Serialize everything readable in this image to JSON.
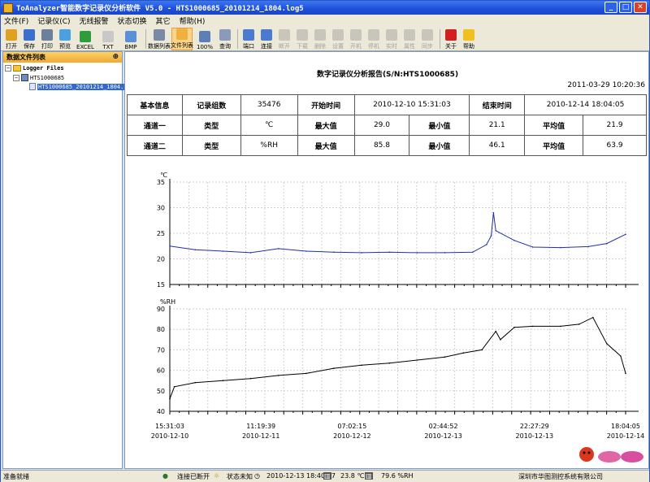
{
  "window": {
    "title": "ToAnalyzer智能数字记录仪分析软件 V5.0 - HTS1000685_20101214_1804.log5"
  },
  "menu": [
    "文件(F)",
    "记录仪(C)",
    "无线报警",
    "状态切换",
    "其它",
    "帮助(H)"
  ],
  "toolbar": [
    {
      "label": "打开",
      "color": "#e0a020",
      "enabled": true
    },
    {
      "label": "保存",
      "color": "#3a6fd0",
      "enabled": true
    },
    {
      "label": "打印",
      "color": "#6d7f9a",
      "enabled": true
    },
    {
      "label": "预览",
      "color": "#4aa0e0",
      "enabled": true
    },
    {
      "label": "EXCEL",
      "color": "#2f9c3c",
      "enabled": true
    },
    {
      "label": "TXT",
      "color": "#c8c8c8",
      "enabled": true
    },
    {
      "label": "BMP",
      "color": "#5b8fd8",
      "enabled": true
    },
    {
      "label": "数据列表",
      "color": "#7a8aa6",
      "enabled": true
    },
    {
      "label": "文件列表",
      "color": "#f0b040",
      "enabled": true,
      "selected": true
    },
    {
      "label": "100%",
      "color": "#5d7fb8",
      "enabled": true
    },
    {
      "label": "查询",
      "color": "#8a9ab8",
      "enabled": true
    },
    {
      "label": "端口",
      "color": "#4b7bd0",
      "enabled": true
    },
    {
      "label": "连接",
      "color": "#4b7bd0",
      "enabled": true
    },
    {
      "label": "断开",
      "color": "#888888",
      "enabled": false
    },
    {
      "label": "下载",
      "color": "#888888",
      "enabled": false
    },
    {
      "label": "删除",
      "color": "#888888",
      "enabled": false
    },
    {
      "label": "设置",
      "color": "#888888",
      "enabled": false
    },
    {
      "label": "开机",
      "color": "#888888",
      "enabled": false
    },
    {
      "label": "停机",
      "color": "#888888",
      "enabled": false
    },
    {
      "label": "实时",
      "color": "#888888",
      "enabled": false
    },
    {
      "label": "属性",
      "color": "#888888",
      "enabled": false
    },
    {
      "label": "同步",
      "color": "#888888",
      "enabled": false
    },
    {
      "label": "关于",
      "color": "#d02020",
      "enabled": true
    },
    {
      "label": "帮助",
      "color": "#f0c020",
      "enabled": true
    }
  ],
  "sidebar": {
    "title": "数据文件列表",
    "pin": "⊕",
    "root": "Logger Files",
    "device": "HTS1000685",
    "file": "HTS1000685_20101214_1804.log5"
  },
  "report": {
    "title": "数字记录仪分析报告(S/N:HTS1000685)",
    "date": "2011-03-29 10:20:36",
    "rows": [
      [
        "基本信息",
        "记录组数",
        "35476",
        "开始时间",
        "2010-12-10 15:31:03",
        "结束时间",
        "2010-12-14 18:04:05"
      ],
      [
        "通道一",
        "类型",
        "℃",
        "最大值",
        "29.0",
        "最小值",
        "21.1",
        "平均值",
        "21.9"
      ],
      [
        "通道二",
        "类型",
        "%RH",
        "最大值",
        "85.8",
        "最小值",
        "46.1",
        "平均值",
        "63.9"
      ]
    ]
  },
  "chart_data": [
    {
      "type": "line",
      "title": "",
      "ylabel": "℃",
      "xlabel": "",
      "ylim": [
        15,
        35
      ],
      "yticks": [
        15,
        20,
        25,
        30,
        35
      ],
      "grid": true,
      "color": "#1f2fa8",
      "x": [
        "2010-12-10 15:31",
        "2010-12-10 21:00",
        "2010-12-11 03:00",
        "2010-12-11 09:00",
        "2010-12-11 15:00",
        "2010-12-11 21:00",
        "2010-12-12 03:00",
        "2010-12-12 09:00",
        "2010-12-12 15:00",
        "2010-12-12 21:00",
        "2010-12-13 03:00",
        "2010-12-13 09:00",
        "2010-12-13 12:00",
        "2010-12-13 13:00",
        "2010-12-13 13:30",
        "2010-12-13 14:00",
        "2010-12-13 18:00",
        "2010-12-13 22:00",
        "2010-12-14 04:00",
        "2010-12-14 10:00",
        "2010-12-14 14:00",
        "2010-12-14 18:04"
      ],
      "values": [
        22.5,
        21.8,
        21.5,
        21.2,
        22.0,
        21.5,
        21.3,
        21.2,
        21.3,
        21.2,
        21.2,
        21.3,
        22.8,
        24.5,
        29.0,
        25.5,
        23.6,
        22.3,
        22.2,
        22.4,
        23.0,
        24.8
      ]
    },
    {
      "type": "line",
      "title": "",
      "ylabel": "%RH",
      "xlabel": "",
      "ylim": [
        40,
        90
      ],
      "yticks": [
        40,
        50,
        60,
        70,
        80,
        90
      ],
      "grid": true,
      "color": "#000000",
      "x": [
        "2010-12-10 15:31",
        "2010-12-10 16:30",
        "2010-12-10 21:00",
        "2010-12-11 03:00",
        "2010-12-11 09:00",
        "2010-12-11 15:00",
        "2010-12-11 21:00",
        "2010-12-12 03:00",
        "2010-12-12 09:00",
        "2010-12-12 15:00",
        "2010-12-12 21:00",
        "2010-12-13 03:00",
        "2010-12-13 07:00",
        "2010-12-13 11:00",
        "2010-12-13 14:00",
        "2010-12-13 15:00",
        "2010-12-13 18:00",
        "2010-12-13 22:00",
        "2010-12-14 04:00",
        "2010-12-14 08:00",
        "2010-12-14 11:00",
        "2010-12-14 14:00",
        "2010-12-14 17:00",
        "2010-12-14 18:04"
      ],
      "values": [
        46.1,
        52.0,
        54.0,
        55.0,
        56.0,
        57.5,
        58.5,
        61.0,
        62.5,
        63.5,
        65.0,
        66.5,
        68.5,
        70.0,
        79.0,
        75.0,
        81.0,
        81.5,
        81.5,
        82.5,
        85.8,
        73.0,
        67.0,
        58.5
      ]
    }
  ],
  "xaxis": [
    {
      "time": "15:31:03",
      "date": "2010-12-10"
    },
    {
      "time": "11:19:39",
      "date": "2010-12-11"
    },
    {
      "time": "07:02:15",
      "date": "2010-12-12"
    },
    {
      "time": "02:44:52",
      "date": "2010-12-13"
    },
    {
      "time": "22:27:29",
      "date": "2010-12-13"
    },
    {
      "time": "18:04:05",
      "date": "2010-12-14"
    }
  ],
  "status": {
    "ready": "准备就绪",
    "connection": "连接已断开",
    "state": "状态未知",
    "datetime": "2010-12-13 18:40:57",
    "temp": "23.8 ℃",
    "hum": "79.6 %RH",
    "company": "深圳市华图测控系统有限公司"
  }
}
